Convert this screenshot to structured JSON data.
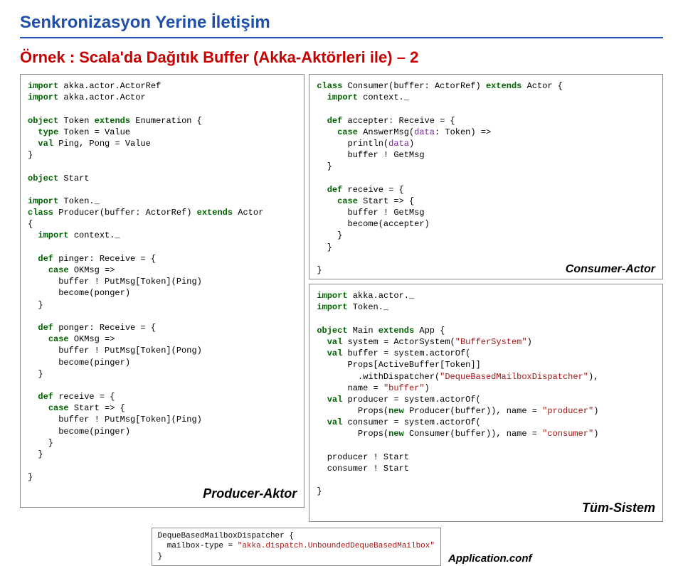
{
  "title": "Senkronizasyon Yerine İletişim",
  "subtitle": "Örnek : Scala'da Dağıtık Buffer (Akka-Aktörleri ile) – 2",
  "left": {
    "code1_html": "<span class='kw'>import</span> akka.actor.ActorRef\n<span class='kw'>import</span> akka.actor.Actor\n\n<span class='kw'>object</span> Token <span class='kw'>extends</span> Enumeration {\n  <span class='kw'>type</span> Token = Value\n  <span class='kw'>val</span> Ping, Pong = Value\n}\n\n<span class='kw'>object</span> Start\n\n<span class='kw'>import</span> Token._\n<span class='kw'>class</span> Producer(buffer: ActorRef) <span class='kw'>extends</span> Actor\n{\n  <span class='kw'>import</span> context._\n\n  <span class='kw'>def</span> pinger: Receive = {\n    <span class='kw'>case</span> OKMsg =>\n      buffer ! PutMsg[Token](Ping)\n      become(ponger)\n  }\n\n  <span class='kw'>def</span> ponger: Receive = {\n    <span class='kw'>case</span> OKMsg =>\n      buffer ! PutMsg[Token](Pong)\n      become(pinger)\n  }\n\n  <span class='kw'>def</span> receive = {\n    <span class='kw'>case</span> Start => {\n      buffer ! PutMsg[Token](Ping)\n      become(pinger)\n    }\n  }\n\n}",
    "label": "Producer-Aktor"
  },
  "right": {
    "code_consumer_html": "<span class='kw'>class</span> Consumer(buffer: ActorRef) <span class='kw'>extends</span> Actor {\n  <span class='kw'>import</span> context._\n\n  <span class='kw'>def</span> accepter: Receive = {\n    <span class='kw'>case</span> AnswerMsg(<span class='tp'>data</span>: Token) =>\n      println(<span class='tp'>data</span>)\n      buffer ! GetMsg\n  }\n\n  <span class='kw'>def</span> receive = {\n    <span class='kw'>case</span> Start => {\n      buffer ! GetMsg\n      become(accepter)\n    }\n  }\n\n}",
    "label_consumer": "Consumer-Actor",
    "code_main_html": "<span class='kw'>import</span> akka.actor._\n<span class='kw'>import</span> Token._\n\n<span class='kw'>object</span> Main <span class='kw'>extends</span> App {\n  <span class='kw'>val</span> system = ActorSystem(<span class='str'>\"BufferSystem\"</span>)\n  <span class='kw'>val</span> buffer = system.actorOf(\n      Props[ActiveBuffer[Token]]\n        .withDispatcher(<span class='str'>\"DequeBasedMailboxDispatcher\"</span>),\n      name = <span class='str'>\"buffer\"</span>)\n  <span class='kw'>val</span> producer = system.actorOf(\n        Props(<span class='kw'>new</span> Producer(buffer)), name = <span class='str'>\"producer\"</span>)\n  <span class='kw'>val</span> consumer = system.actorOf(\n        Props(<span class='kw'>new</span> Consumer(buffer)), name = <span class='str'>\"consumer\"</span>)\n\n  producer ! Start\n  consumer ! Start\n\n}",
    "label_main": "Tüm-Sistem"
  },
  "footer": {
    "code_html": "DequeBasedMailboxDispatcher {\n  mailbox-type = <span class='str'>\"akka.dispatch.UnboundedDequeBasedMailbox\"</span>\n}",
    "label": "Application.conf"
  }
}
